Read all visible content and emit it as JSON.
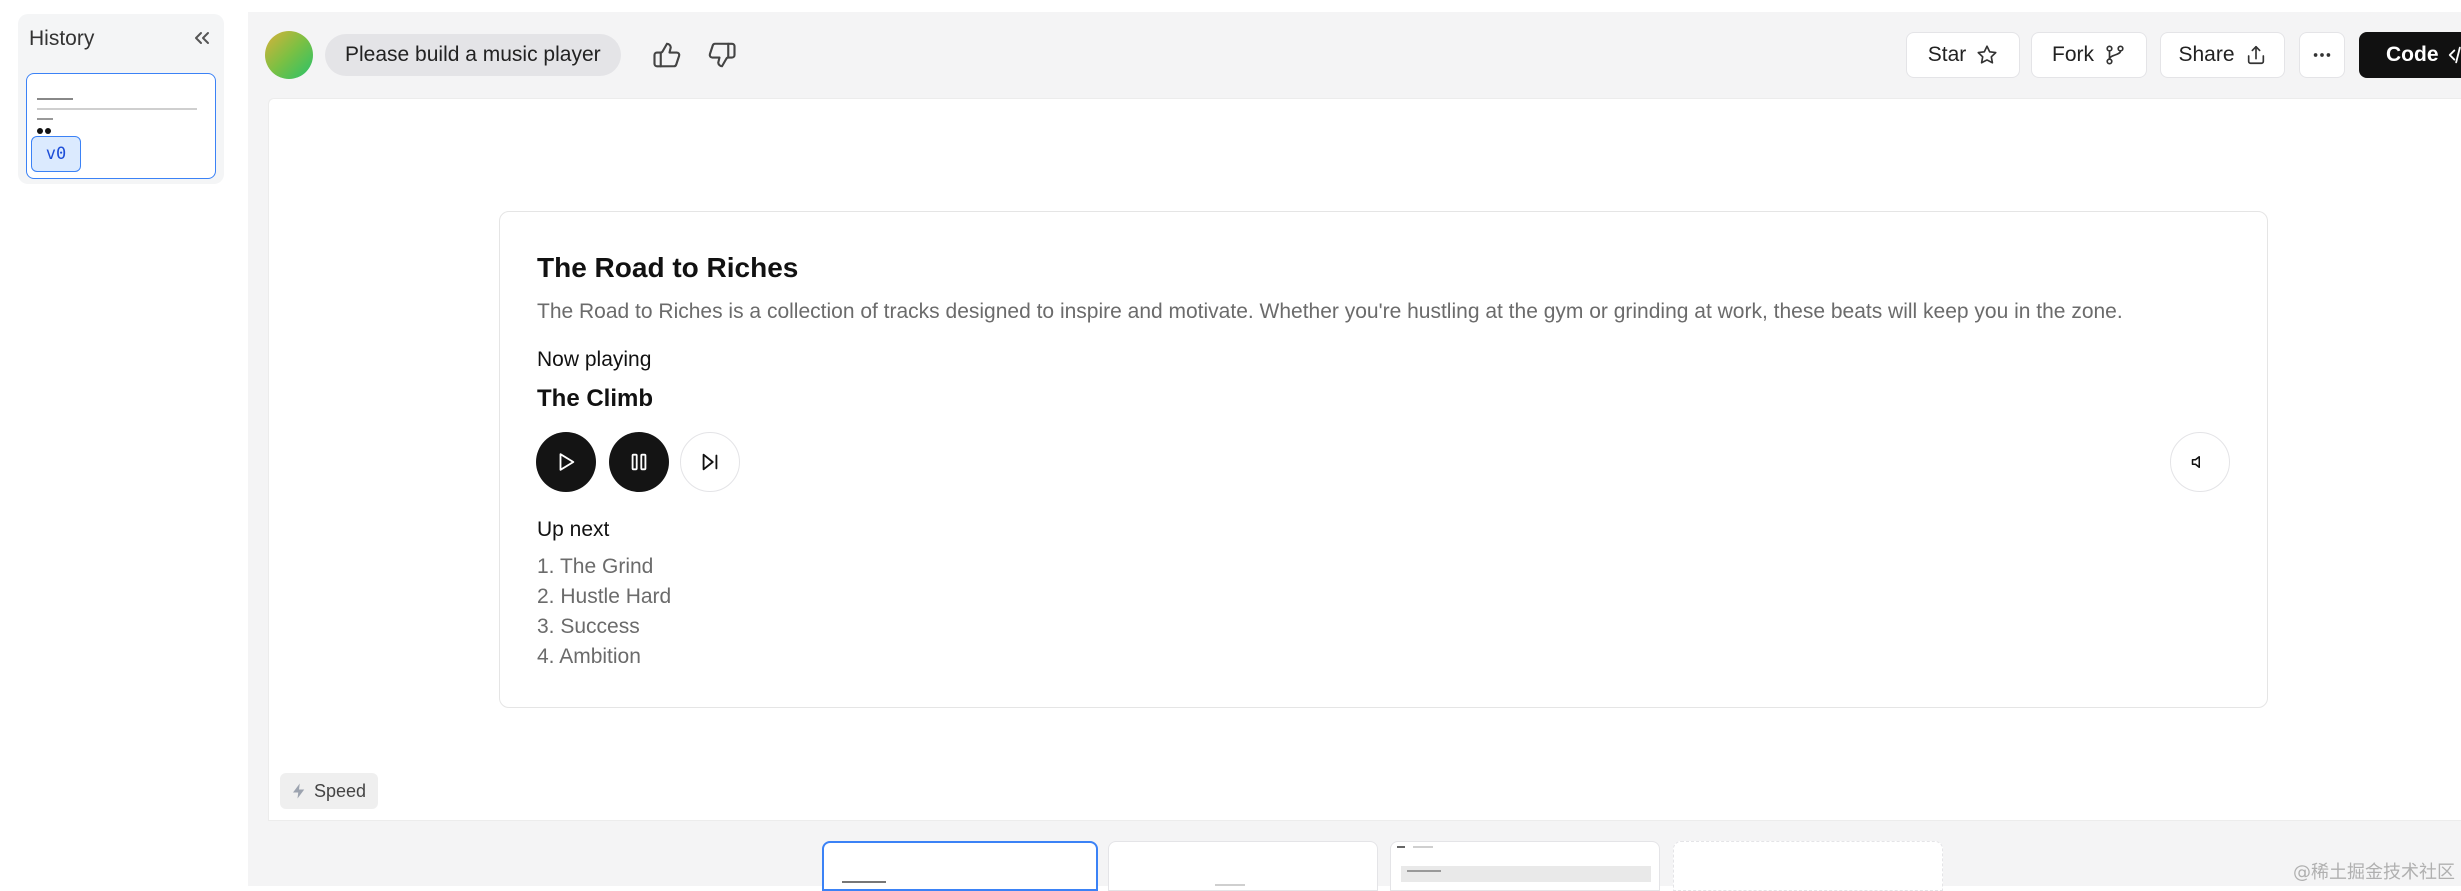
{
  "sidebar": {
    "title": "History",
    "versions": [
      {
        "label": "v0",
        "selected": true
      }
    ]
  },
  "header": {
    "prompt": "Please build a music player",
    "buttons": {
      "star": "Star",
      "fork": "Fork",
      "share": "Share",
      "code": "Code"
    }
  },
  "player": {
    "title": "The Road to Riches",
    "description": "The Road to Riches is a collection of tracks designed to inspire and motivate. Whether you're hustling at the gym or grinding at work, these beats will keep you in the zone.",
    "now_playing_label": "Now playing",
    "current_track": "The Climb",
    "up_next_label": "Up next",
    "queue": [
      "1. The Grind",
      "2. Hustle Hard",
      "3. Success",
      "4. Ambition"
    ],
    "controls": [
      "play-icon",
      "pause-icon",
      "skip-forward-icon",
      "volume-icon"
    ]
  },
  "footer": {
    "speed_label": "Speed",
    "previews": [
      {
        "active": true
      },
      {
        "active": false
      },
      {
        "active": false
      },
      {
        "active": false
      }
    ],
    "watermark": "@稀土掘金技术社区"
  },
  "colors": {
    "accent": "#3b82f6",
    "dark": "#141414",
    "muted": "#6b6b6b",
    "surface": "#f4f4f5"
  }
}
